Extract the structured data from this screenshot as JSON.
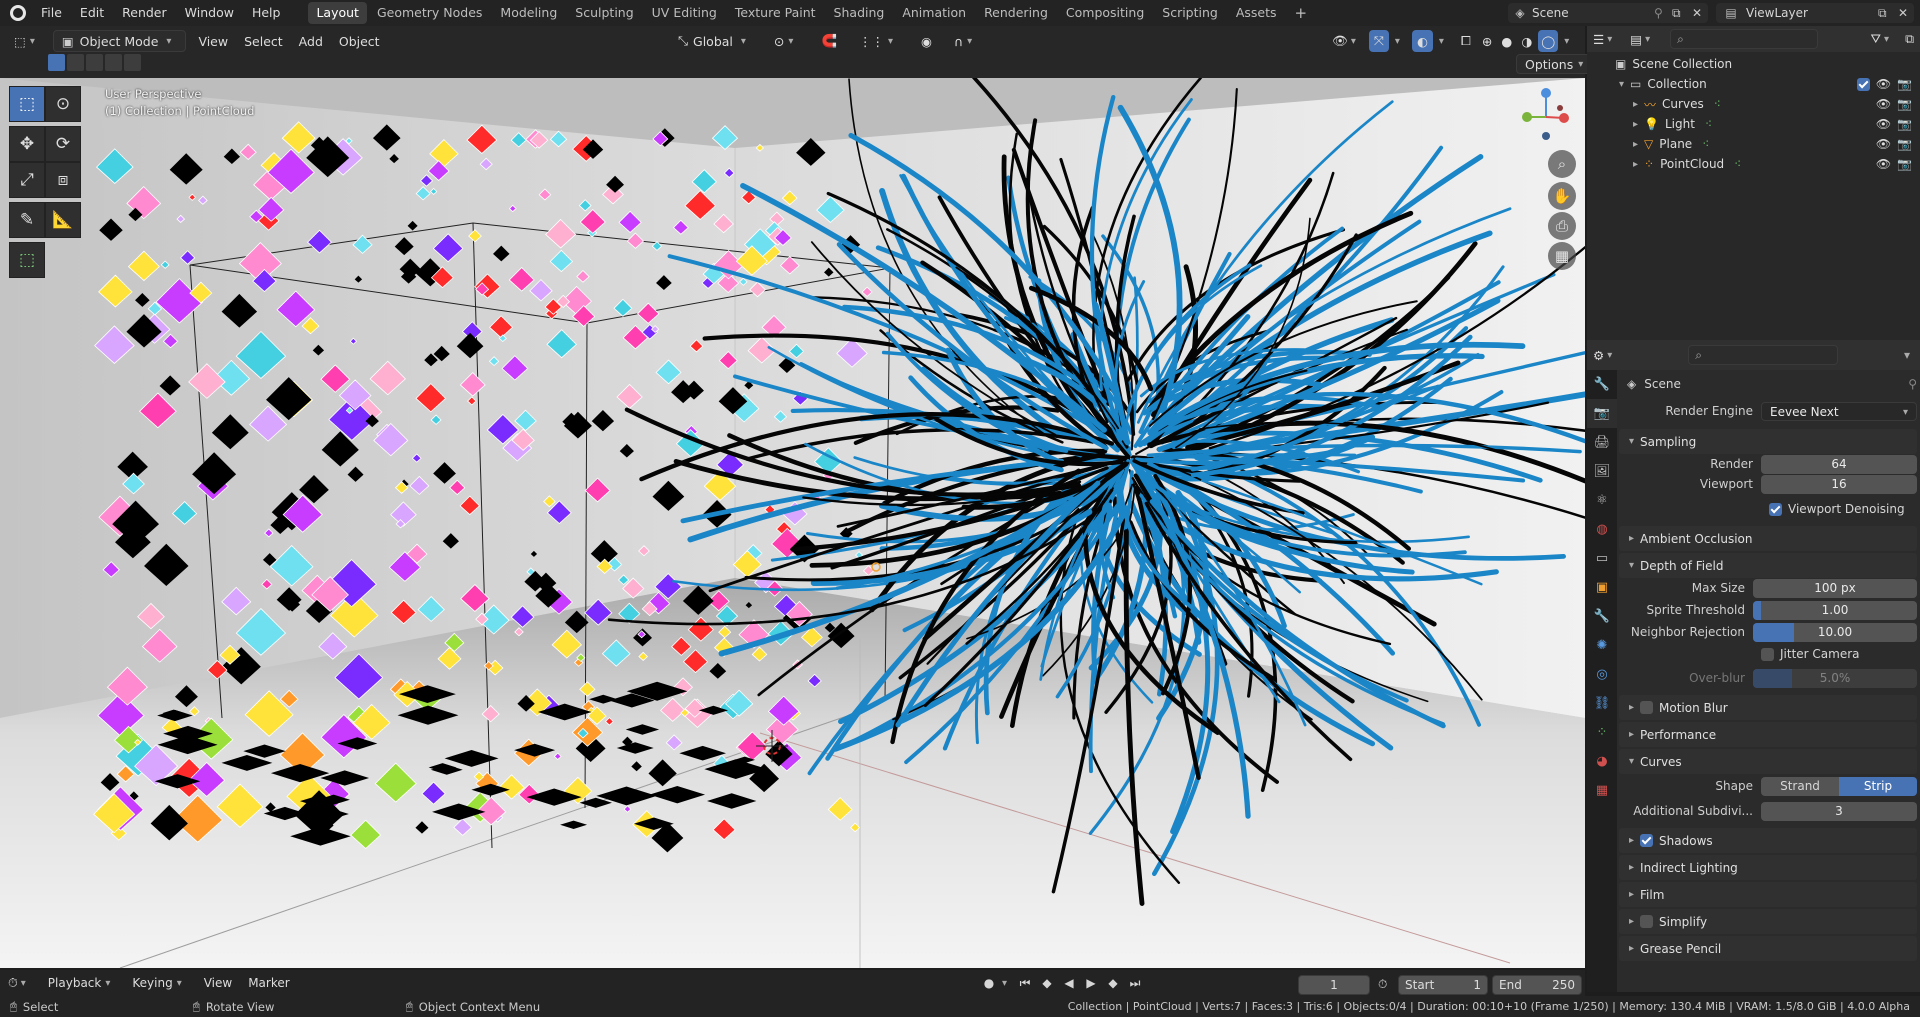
{
  "topbar": {
    "menus": [
      "File",
      "Edit",
      "Render",
      "Window",
      "Help"
    ],
    "workspaces": [
      "Layout",
      "Geometry Nodes",
      "Modeling",
      "Sculpting",
      "UV Editing",
      "Texture Paint",
      "Shading",
      "Animation",
      "Rendering",
      "Compositing",
      "Scripting",
      "Assets"
    ],
    "active_workspace": "Layout",
    "add_workspace": "+",
    "scene_name": "Scene",
    "view_layer": "ViewLayer"
  },
  "viewport_header": {
    "mode": "Object Mode",
    "menus": [
      "View",
      "Select",
      "Add",
      "Object"
    ],
    "transform_orientation": "Global",
    "options": "Options"
  },
  "viewport": {
    "perspective": "User Perspective",
    "context": "(1) Collection | PointCloud",
    "gizmo_axes": [
      "X",
      "Y",
      "Z"
    ]
  },
  "outliner": {
    "search_placeholder": "",
    "scene_collection": "Scene Collection",
    "collection": "Collection",
    "items": [
      {
        "name": "Curves",
        "icon": "curves-icon"
      },
      {
        "name": "Light",
        "icon": "light-icon"
      },
      {
        "name": "Plane",
        "icon": "mesh-icon"
      },
      {
        "name": "PointCloud",
        "icon": "pointcloud-icon"
      }
    ]
  },
  "properties": {
    "context_title": "Scene",
    "render_engine_label": "Render Engine",
    "render_engine": "Eevee Next",
    "sampling": {
      "title": "Sampling",
      "render_label": "Render",
      "render": "64",
      "viewport_label": "Viewport",
      "viewport": "16",
      "denoise_label": "Viewport Denoising"
    },
    "ambient_occlusion": "Ambient Occlusion",
    "dof": {
      "title": "Depth of Field",
      "max_size_label": "Max Size",
      "max_size": "100 px",
      "sprite_label": "Sprite Threshold",
      "sprite": "1.00",
      "sprite_fraction": 0.05,
      "neighbor_label": "Neighbor Rejection",
      "neighbor": "10.00",
      "neighbor_fraction": 0.25,
      "jitter_label": "Jitter Camera",
      "overblur_label": "Over-blur",
      "overblur": "5.0%",
      "overblur_fraction": 0.24
    },
    "motion_blur": "Motion Blur",
    "performance": "Performance",
    "curves": {
      "title": "Curves",
      "shape_label": "Shape",
      "shape_options": [
        "Strand",
        "Strip"
      ],
      "shape_selected": "Strip",
      "subdiv_label": "Additional Subdivi...",
      "subdiv": "3"
    },
    "shadows": "Shadows",
    "indirect": "Indirect Lighting",
    "film": "Film",
    "simplify": "Simplify",
    "grease_pencil": "Grease Pencil"
  },
  "timeline": {
    "menus": [
      "Playback",
      "Keying",
      "View",
      "Marker"
    ],
    "current_frame": "1",
    "start_label": "Start",
    "start": "1",
    "end_label": "End",
    "end": "250"
  },
  "statusbar": {
    "select": "Select",
    "rotate": "Rotate View",
    "context_menu": "Object Context Menu",
    "stats": "Collection | PointCloud | Verts:7 | Faces:3 | Tris:6 | Objects:0/4 | Duration: 00:10+10 (Frame 1/250) | Memory: 130.4 MiB | VRAM: 1.5/8.0 GiB | 4.0.0 Alpha"
  },
  "colors": {
    "accent": "#4772b3",
    "bg": "#1d1d1d",
    "panel": "#2b2b2b",
    "curves_blue": "#1a86c8"
  }
}
